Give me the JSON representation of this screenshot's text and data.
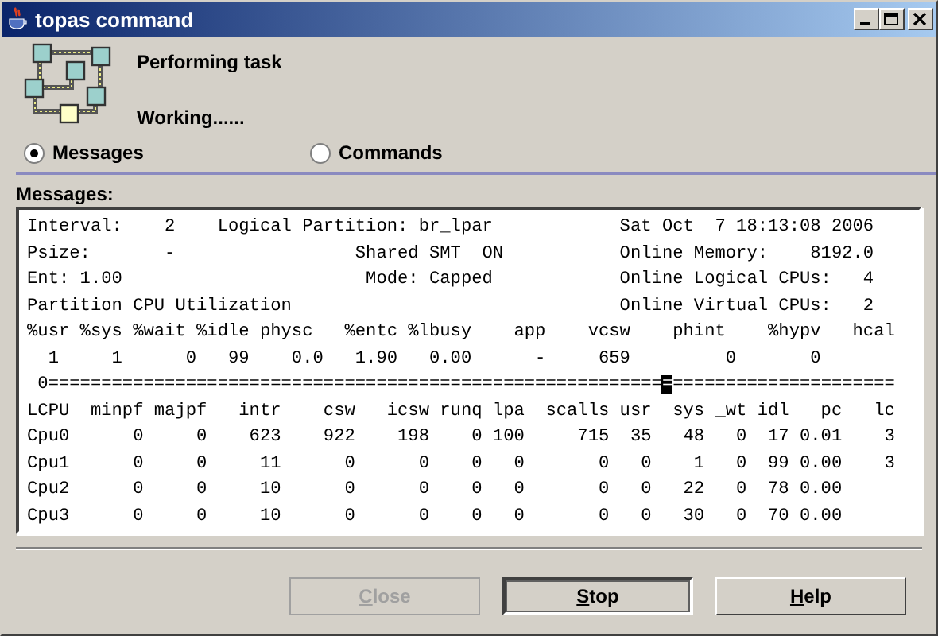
{
  "window": {
    "title": "topas command"
  },
  "status": {
    "task": "Performing task",
    "progress": "Working......"
  },
  "views": [
    {
      "label": "Messages",
      "selected": true
    },
    {
      "label": "Commands",
      "selected": false
    }
  ],
  "messages": {
    "label": "Messages:",
    "lines": [
      {
        "kind": "text",
        "text": "Interval:    2    Logical Partition: br_lpar            Sat Oct  7 18:13:08 2006"
      },
      {
        "kind": "text",
        "text": "Psize:       -                 Shared SMT  ON           Online Memory:    8192.0"
      },
      {
        "kind": "text",
        "text": "Ent: 1.00                       Mode: Capped            Online Logical CPUs:   4"
      },
      {
        "kind": "text",
        "text": "Partition CPU Utilization                               Online Virtual CPUs:   2"
      },
      {
        "kind": "text",
        "text": "%usr %sys %wait %idle physc   %entc %lbusy    app    vcsw    phint    %hypv   hcal"
      },
      {
        "kind": "text",
        "text": "  1     1      0   99    0.0   1.90   0.00      -     659         0       0"
      },
      {
        "kind": "meter",
        "before": " 0==========================================================",
        "cursor": "=",
        "after": "====================="
      },
      {
        "kind": "text",
        "text": "LCPU  minpf majpf   intr    csw   icsw runq lpa  scalls usr  sys _wt idl   pc   lc"
      },
      {
        "kind": "text",
        "text": "Cpu0      0     0    623    922    198    0 100     715  35   48   0  17 0.01    3"
      },
      {
        "kind": "text",
        "text": "Cpu1      0     0     11      0      0    0   0       0   0    1   0  99 0.00    3"
      },
      {
        "kind": "text",
        "text": "Cpu2      0     0     10      0      0    0   0       0   0   22   0  78 0.00"
      },
      {
        "kind": "text",
        "text": "Cpu3      0     0     10      0      0    0   0       0   0   30   0  70 0.00"
      }
    ]
  },
  "buttons": [
    {
      "label": "Close",
      "disabled": true,
      "default": false
    },
    {
      "label": "Stop",
      "disabled": false,
      "default": true
    },
    {
      "label": "Help",
      "disabled": false,
      "default": false
    }
  ]
}
